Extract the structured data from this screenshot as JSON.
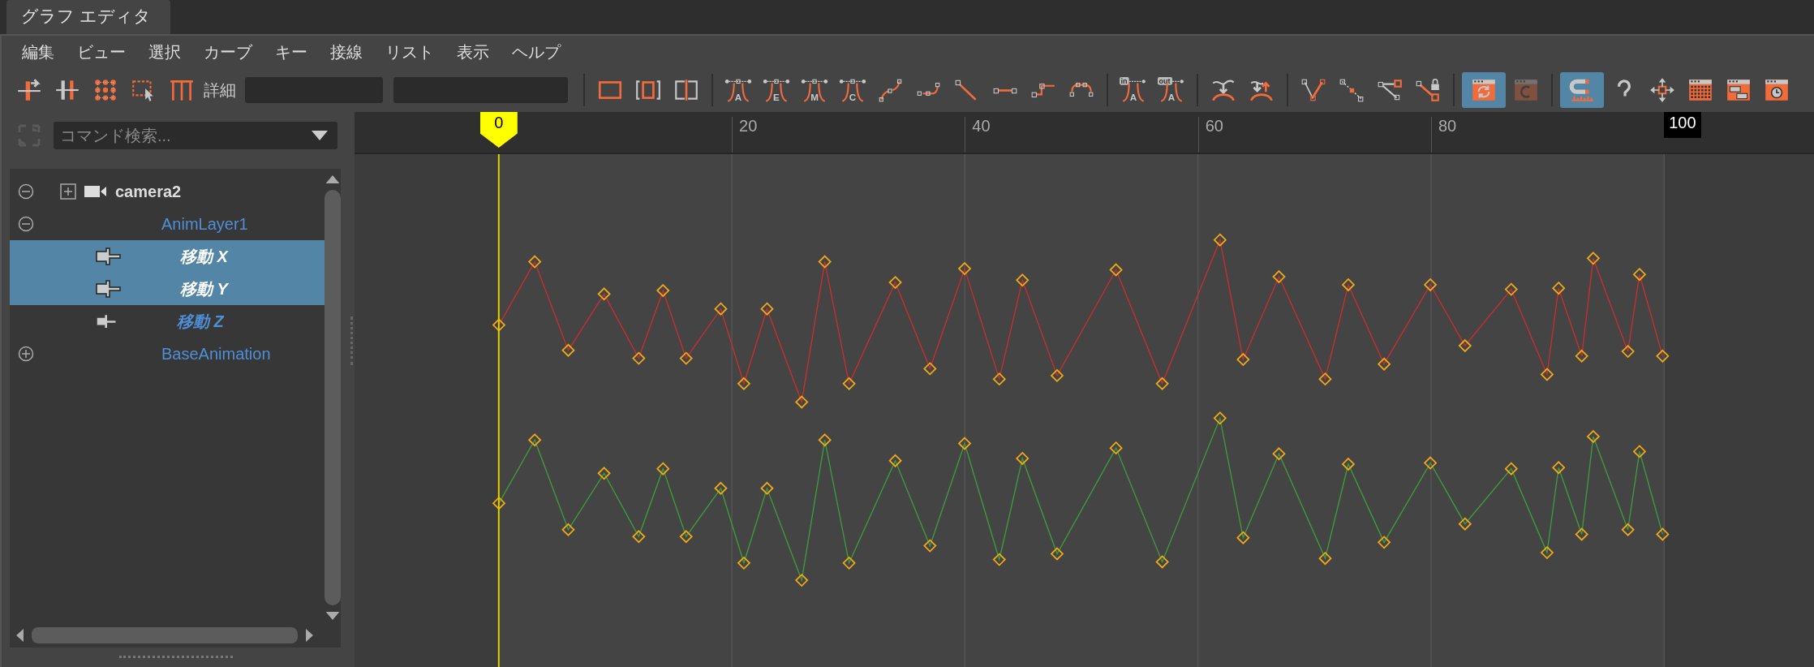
{
  "tab": {
    "title": "グラフ エディタ"
  },
  "menu": [
    "編集",
    "ビュー",
    "選択",
    "カーブ",
    "キー",
    "接線",
    "リスト",
    "表示",
    "ヘルプ"
  ],
  "toolbar": [
    [
      {
        "kind": "move-key",
        "on": false,
        "disabled": false
      },
      {
        "kind": "key-bars",
        "on": false,
        "disabled": false
      },
      {
        "kind": "dot-grid",
        "on": false,
        "disabled": false
      },
      {
        "kind": "region-select",
        "on": false,
        "disabled": false
      },
      {
        "kind": "retime",
        "on": false,
        "disabled": false
      },
      {
        "kind": "label",
        "label": "詳細"
      },
      {
        "kind": "field"
      },
      {
        "kind": "field"
      }
    ],
    [
      {
        "kind": "frame-all",
        "on": false,
        "disabled": false
      },
      {
        "kind": "frame-selection",
        "on": false,
        "disabled": false
      },
      {
        "kind": "frame-playback",
        "on": false,
        "disabled": false
      }
    ],
    [
      {
        "kind": "tangent-letter",
        "label": "A",
        "on": false,
        "disabled": false
      },
      {
        "kind": "tangent-letter",
        "label": "E",
        "on": false,
        "disabled": false
      },
      {
        "kind": "tangent-letter",
        "label": "M",
        "on": false,
        "disabled": false
      },
      {
        "kind": "tangent-letter",
        "label": "C",
        "on": false,
        "disabled": false
      },
      {
        "kind": "spline",
        "on": false,
        "disabled": false
      },
      {
        "kind": "clamped",
        "on": false,
        "disabled": false
      },
      {
        "kind": "linear",
        "on": false,
        "disabled": false
      },
      {
        "kind": "flat",
        "on": false,
        "disabled": false
      },
      {
        "kind": "step",
        "on": false,
        "disabled": false
      },
      {
        "kind": "plateau",
        "on": false,
        "disabled": false
      }
    ],
    [
      {
        "kind": "tagged-tangent",
        "tag": "in",
        "label": "A",
        "on": false,
        "disabled": false
      },
      {
        "kind": "tagged-tangent",
        "tag": "out",
        "label": "A",
        "on": false,
        "disabled": false
      }
    ],
    [
      {
        "kind": "buffer-down",
        "on": false,
        "disabled": false
      },
      {
        "kind": "buffer-swap",
        "on": false,
        "disabled": false
      }
    ],
    [
      {
        "kind": "break",
        "on": false,
        "disabled": false
      },
      {
        "kind": "unify",
        "on": false,
        "disabled": false
      },
      {
        "kind": "free-weight",
        "on": false,
        "disabled": false
      },
      {
        "kind": "lock-weight",
        "on": false,
        "disabled": false
      }
    ],
    [
      {
        "kind": "auto-load",
        "on": true,
        "disabled": false
      },
      {
        "kind": "load-selected",
        "on": false,
        "disabled": true
      }
    ],
    [
      {
        "kind": "magnet",
        "on": true,
        "disabled": false
      },
      {
        "kind": "hook",
        "on": false,
        "disabled": false
      },
      {
        "kind": "move-arrows",
        "on": false,
        "disabled": false
      },
      {
        "kind": "grid-window",
        "on": false,
        "disabled": false
      },
      {
        "kind": "blocks-window",
        "on": false,
        "disabled": false
      },
      {
        "kind": "clock-window",
        "on": false,
        "disabled": false
      }
    ]
  ],
  "command_search": {
    "placeholder": "コマンド検索..."
  },
  "outliner": [
    {
      "kind": "object",
      "name": "camera2",
      "expanded": true,
      "children": [
        {
          "kind": "layer",
          "name": "AnimLayer1",
          "expanded": true,
          "children": [
            {
              "kind": "attribute",
              "name": "移動 X",
              "selected": true
            },
            {
              "kind": "attribute",
              "name": "移動 Y",
              "selected": true
            },
            {
              "kind": "attribute",
              "name": "移動 Z",
              "selected": false
            }
          ]
        },
        {
          "kind": "layer",
          "name": "BaseAnimation",
          "expanded": false
        }
      ]
    }
  ],
  "ruler": {
    "current_frame": "0",
    "tick_labels": [
      "20",
      "40",
      "60",
      "80"
    ],
    "end_frame": "100"
  }
}
